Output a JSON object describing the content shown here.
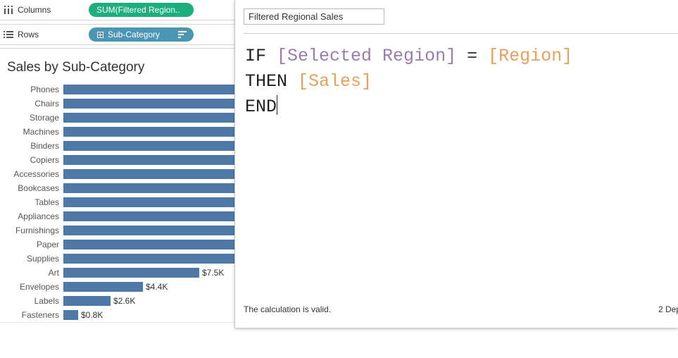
{
  "shelves": {
    "columns": {
      "label": "Columns",
      "pill": "SUM(Filtered Region.."
    },
    "rows": {
      "label": "Rows",
      "pill": "Sub-Category"
    }
  },
  "colors": {
    "bar": "#4e79a7",
    "pill_green": "#1cae7c",
    "pill_blue": "#4a96b4",
    "field_purple": "#9b7bb0",
    "field_orange": "#e8a060"
  },
  "chart_data": {
    "type": "bar",
    "orientation": "horizontal",
    "title": "Sales by Sub-Category",
    "categories": [
      "Phones",
      "Chairs",
      "Storage",
      "Machines",
      "Binders",
      "Copiers",
      "Accessories",
      "Bookcases",
      "Tables",
      "Appliances",
      "Furnishings",
      "Paper",
      "Supplies",
      "Art",
      "Envelopes",
      "Labels",
      "Fasteners"
    ],
    "values": [
      null,
      null,
      null,
      null,
      null,
      null,
      null,
      null,
      null,
      null,
      null,
      null,
      null,
      7.5,
      4.4,
      2.6,
      0.8
    ],
    "data_labels": [
      "",
      "",
      "",
      "",
      "",
      "",
      "",
      "",
      "",
      "",
      "",
      "",
      "",
      "$7.5K",
      "$4.4K",
      "$2.6K",
      "$0.8K"
    ],
    "unit": "$K",
    "xlim": [
      0,
      13.8
    ],
    "clipped": true
  },
  "calc": {
    "name": "Filtered Regional Sales",
    "line1": {
      "kw": "IF",
      "field1": "[Selected Region]",
      "op": "=",
      "field2": "[Region]"
    },
    "line2": {
      "kw": "THEN",
      "field": "[Sales]"
    },
    "line3": {
      "kw": "END"
    },
    "status": "The calculation is valid.",
    "dependencies": "2 Dep"
  }
}
